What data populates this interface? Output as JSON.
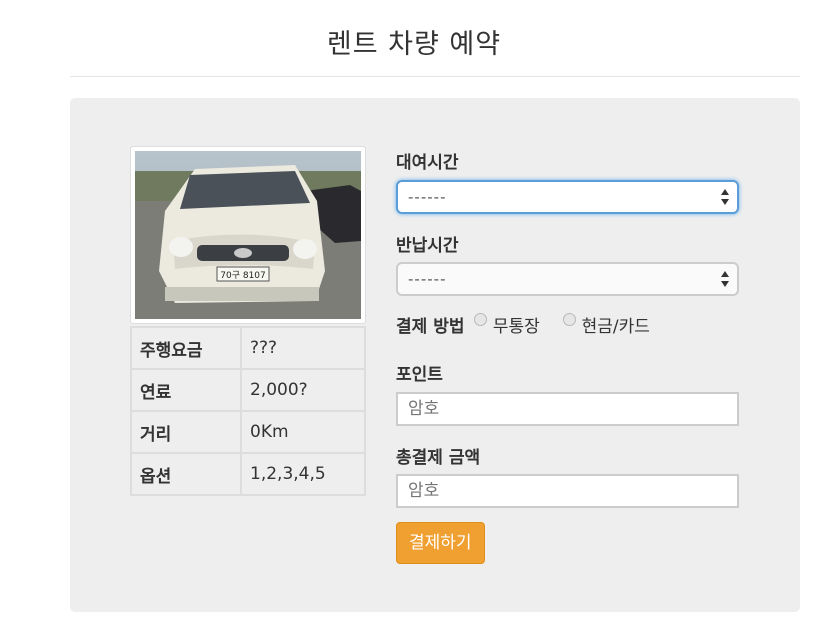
{
  "page": {
    "title": "렌트 차량 예약"
  },
  "car": {
    "image_alt": "car photo",
    "specs": [
      {
        "key": "주행요금",
        "value": "???"
      },
      {
        "key": "연료",
        "value": "2,000?"
      },
      {
        "key": "거리",
        "value": "0Km"
      },
      {
        "key": "옵션",
        "value": "1,2,3,4,5"
      }
    ],
    "plate": "70구 8107"
  },
  "form": {
    "rent_time_label": "대여시간",
    "rent_time_value": "------",
    "return_time_label": "반납시간",
    "return_time_value": "------",
    "payment_label": "결제 방법",
    "payment_options": [
      "무통장",
      "현금/카드"
    ],
    "point_label": "포인트",
    "point_placeholder": "암호",
    "total_label": "총결제 금액",
    "total_placeholder": "암호",
    "submit_label": "결제하기"
  },
  "colors": {
    "button": "#f0a030",
    "focus": "#66afe9",
    "panel": "#eeeeee"
  },
  "icons": [
    "select-arrows-icon",
    "radio-icon"
  ]
}
